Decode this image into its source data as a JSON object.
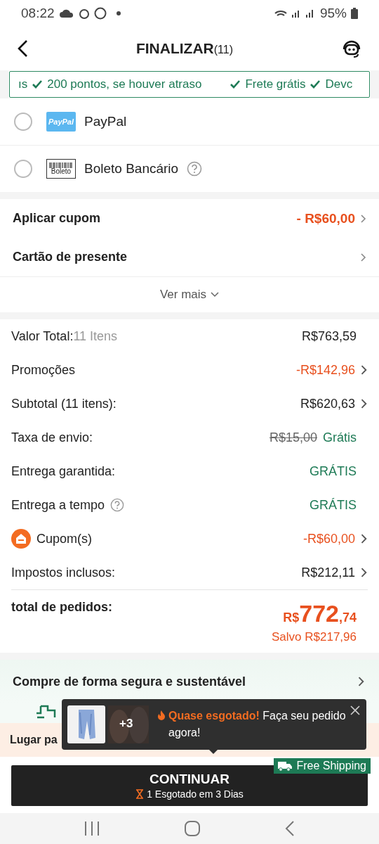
{
  "status_bar": {
    "time": "08:22",
    "battery": "95%"
  },
  "header": {
    "title": "FINALIZAR",
    "count": "(11)"
  },
  "benefits": [
    "ıs",
    "200 pontos, se houver atraso",
    "Frete grátis",
    "Devc"
  ],
  "payment_methods": [
    {
      "name": "PayPal",
      "logo": "PayPal",
      "kind": "paypal",
      "selected": false,
      "help": false
    },
    {
      "name": "Boleto Bancário",
      "logo": "Boleto",
      "kind": "boleto",
      "selected": false,
      "help": true
    }
  ],
  "options": [
    {
      "label": "Aplicar cupom",
      "value": "- R$60,00"
    },
    {
      "label": "Cartão de presente"
    }
  ],
  "more": "Ver mais",
  "summary": [
    {
      "label": "Valor Total:",
      "note": "11 Itens",
      "value": "R$763,59",
      "kind": "plain",
      "chevron": false,
      "help": false,
      "icon": false
    },
    {
      "label": "Promoções",
      "value": "-R$142,96",
      "kind": "discount",
      "chevron": true,
      "help": false,
      "icon": false
    },
    {
      "label": "Subtotal (11 itens):",
      "value": "R$620,63",
      "kind": "plain",
      "chevron": true,
      "help": false,
      "icon": false
    },
    {
      "label": "Taxa de envio:",
      "old_value": "R$15,00",
      "value": "Grátis",
      "kind": "free",
      "chevron": false,
      "help": false,
      "icon": false
    },
    {
      "label": "Entrega garantida:",
      "value": "GRÁTIS",
      "kind": "free",
      "chevron": false,
      "help": false,
      "icon": false
    },
    {
      "label": "Entrega a tempo",
      "value": "GRÁTIS",
      "kind": "free",
      "chevron": false,
      "help": true,
      "icon": false
    },
    {
      "label": "Cupom(s)",
      "value": "-R$60,00",
      "kind": "discount",
      "chevron": true,
      "help": false,
      "icon": true
    },
    {
      "label": "Impostos inclusos:",
      "value": "R$212,11",
      "kind": "plain",
      "chevron": true,
      "help": false,
      "icon": false
    }
  ],
  "total": {
    "label": "total de pedidos:",
    "currency": "R$",
    "integer": "772",
    "cents": ",74",
    "saved": "Salvo R$217,96"
  },
  "secure": {
    "title": "Compre de forma segura e sustentável"
  },
  "rewards": {
    "text": "Lugar pa"
  },
  "popup": {
    "more": "+3",
    "highlight": "Quase esgotado!",
    "message": "Faça seu pedido agora!"
  },
  "free_shipping": "Free Shipping",
  "continue": {
    "label": "CONTINUAR",
    "note": "1 Esgotado em 3 Dias"
  }
}
